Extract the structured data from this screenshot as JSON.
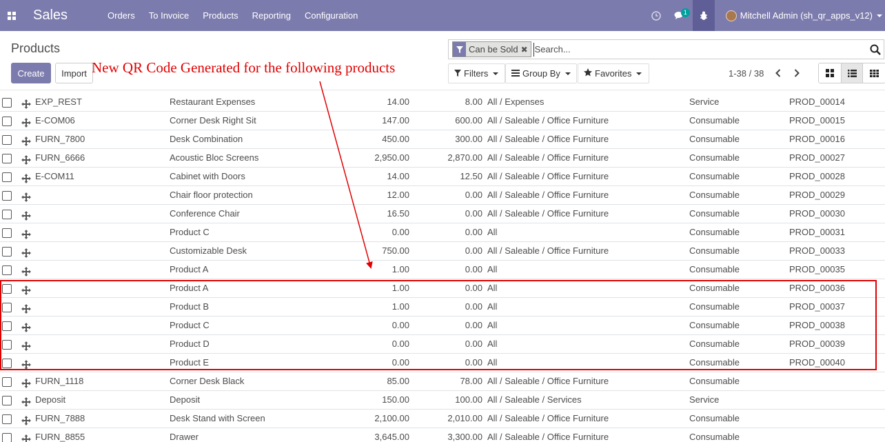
{
  "navbar": {
    "app_name": "Sales",
    "menu": [
      "Orders",
      "To Invoice",
      "Products",
      "Reporting",
      "Configuration"
    ],
    "messages_badge": "1",
    "user_name": "Mitchell Admin (sh_qr_apps_v12)",
    "bar_color": "#7c7bad"
  },
  "control_panel": {
    "breadcrumb": "Products",
    "create_label": "Create",
    "import_label": "Import",
    "search_facet": "Can be Sold",
    "search_placeholder": "Search...",
    "filters_label": "Filters",
    "groupby_label": "Group By",
    "favorites_label": "Favorites",
    "pager_text": "1-38 / 38"
  },
  "annotation": {
    "text": "New QR Code Generated for the following products",
    "color": "#e00000"
  },
  "rows": [
    {
      "ref": "EXP_REST",
      "name": "Restaurant Expenses",
      "price": "14.00",
      "cost": "8.00",
      "category": "All / Expenses",
      "type": "Service",
      "code": "PROD_00014"
    },
    {
      "ref": "E-COM06",
      "name": "Corner Desk Right Sit",
      "price": "147.00",
      "cost": "600.00",
      "category": "All / Saleable / Office Furniture",
      "type": "Consumable",
      "code": "PROD_00015"
    },
    {
      "ref": "FURN_7800",
      "name": "Desk Combination",
      "price": "450.00",
      "cost": "300.00",
      "category": "All / Saleable / Office Furniture",
      "type": "Consumable",
      "code": "PROD_00016"
    },
    {
      "ref": "FURN_6666",
      "name": "Acoustic Bloc Screens",
      "price": "2,950.00",
      "cost": "2,870.00",
      "category": "All / Saleable / Office Furniture",
      "type": "Consumable",
      "code": "PROD_00027"
    },
    {
      "ref": "E-COM11",
      "name": "Cabinet with Doors",
      "price": "14.00",
      "cost": "12.50",
      "category": "All / Saleable / Office Furniture",
      "type": "Consumable",
      "code": "PROD_00028"
    },
    {
      "ref": "",
      "name": "Chair floor protection",
      "price": "12.00",
      "cost": "0.00",
      "category": "All / Saleable / Office Furniture",
      "type": "Consumable",
      "code": "PROD_00029"
    },
    {
      "ref": "",
      "name": "Conference Chair",
      "price": "16.50",
      "cost": "0.00",
      "category": "All / Saleable / Office Furniture",
      "type": "Consumable",
      "code": "PROD_00030"
    },
    {
      "ref": "",
      "name": "Product C",
      "price": "0.00",
      "cost": "0.00",
      "category": "All",
      "type": "Consumable",
      "code": "PROD_00031"
    },
    {
      "ref": "",
      "name": "Customizable Desk",
      "price": "750.00",
      "cost": "0.00",
      "category": "All / Saleable / Office Furniture",
      "type": "Consumable",
      "code": "PROD_00033"
    },
    {
      "ref": "",
      "name": "Product A",
      "price": "1.00",
      "cost": "0.00",
      "category": "All",
      "type": "Consumable",
      "code": "PROD_00035"
    },
    {
      "ref": "",
      "name": "Product A",
      "price": "1.00",
      "cost": "0.00",
      "category": "All",
      "type": "Consumable",
      "code": "PROD_00036"
    },
    {
      "ref": "",
      "name": "Product B",
      "price": "1.00",
      "cost": "0.00",
      "category": "All",
      "type": "Consumable",
      "code": "PROD_00037"
    },
    {
      "ref": "",
      "name": "Product C",
      "price": "0.00",
      "cost": "0.00",
      "category": "All",
      "type": "Consumable",
      "code": "PROD_00038"
    },
    {
      "ref": "",
      "name": "Product D",
      "price": "0.00",
      "cost": "0.00",
      "category": "All",
      "type": "Consumable",
      "code": "PROD_00039"
    },
    {
      "ref": "",
      "name": "Product E",
      "price": "0.00",
      "cost": "0.00",
      "category": "All",
      "type": "Consumable",
      "code": "PROD_00040"
    },
    {
      "ref": "FURN_1118",
      "name": "Corner Desk Black",
      "price": "85.00",
      "cost": "78.00",
      "category": "All / Saleable / Office Furniture",
      "type": "Consumable",
      "code": ""
    },
    {
      "ref": "Deposit",
      "name": "Deposit",
      "price": "150.00",
      "cost": "100.00",
      "category": "All / Saleable / Services",
      "type": "Service",
      "code": ""
    },
    {
      "ref": "FURN_7888",
      "name": "Desk Stand with Screen",
      "price": "2,100.00",
      "cost": "2,010.00",
      "category": "All / Saleable / Office Furniture",
      "type": "Consumable",
      "code": ""
    },
    {
      "ref": "FURN_8855",
      "name": "Drawer",
      "price": "3,645.00",
      "cost": "3,300.00",
      "category": "All / Saleable / Office Furniture",
      "type": "Consumable",
      "code": ""
    }
  ]
}
